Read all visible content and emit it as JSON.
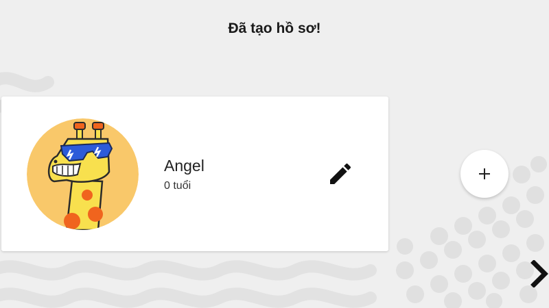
{
  "header": {
    "title": "Đã tạo hồ sơ!"
  },
  "profiles": [
    {
      "name": "Angel",
      "age": "0 tuổi",
      "avatar_icon": "giraffe-sunglasses-icon"
    }
  ],
  "actions": {
    "edit_icon": "pencil-icon",
    "add_icon": "plus-icon",
    "next_icon": "chevron-right-icon"
  },
  "colors": {
    "background": "#efefef",
    "card": "#ffffff",
    "avatar_bg": "#f9c86a",
    "giraffe_yellow": "#f8e04e",
    "giraffe_spots": "#f0641e",
    "sunglasses": "#2c5bd9"
  }
}
